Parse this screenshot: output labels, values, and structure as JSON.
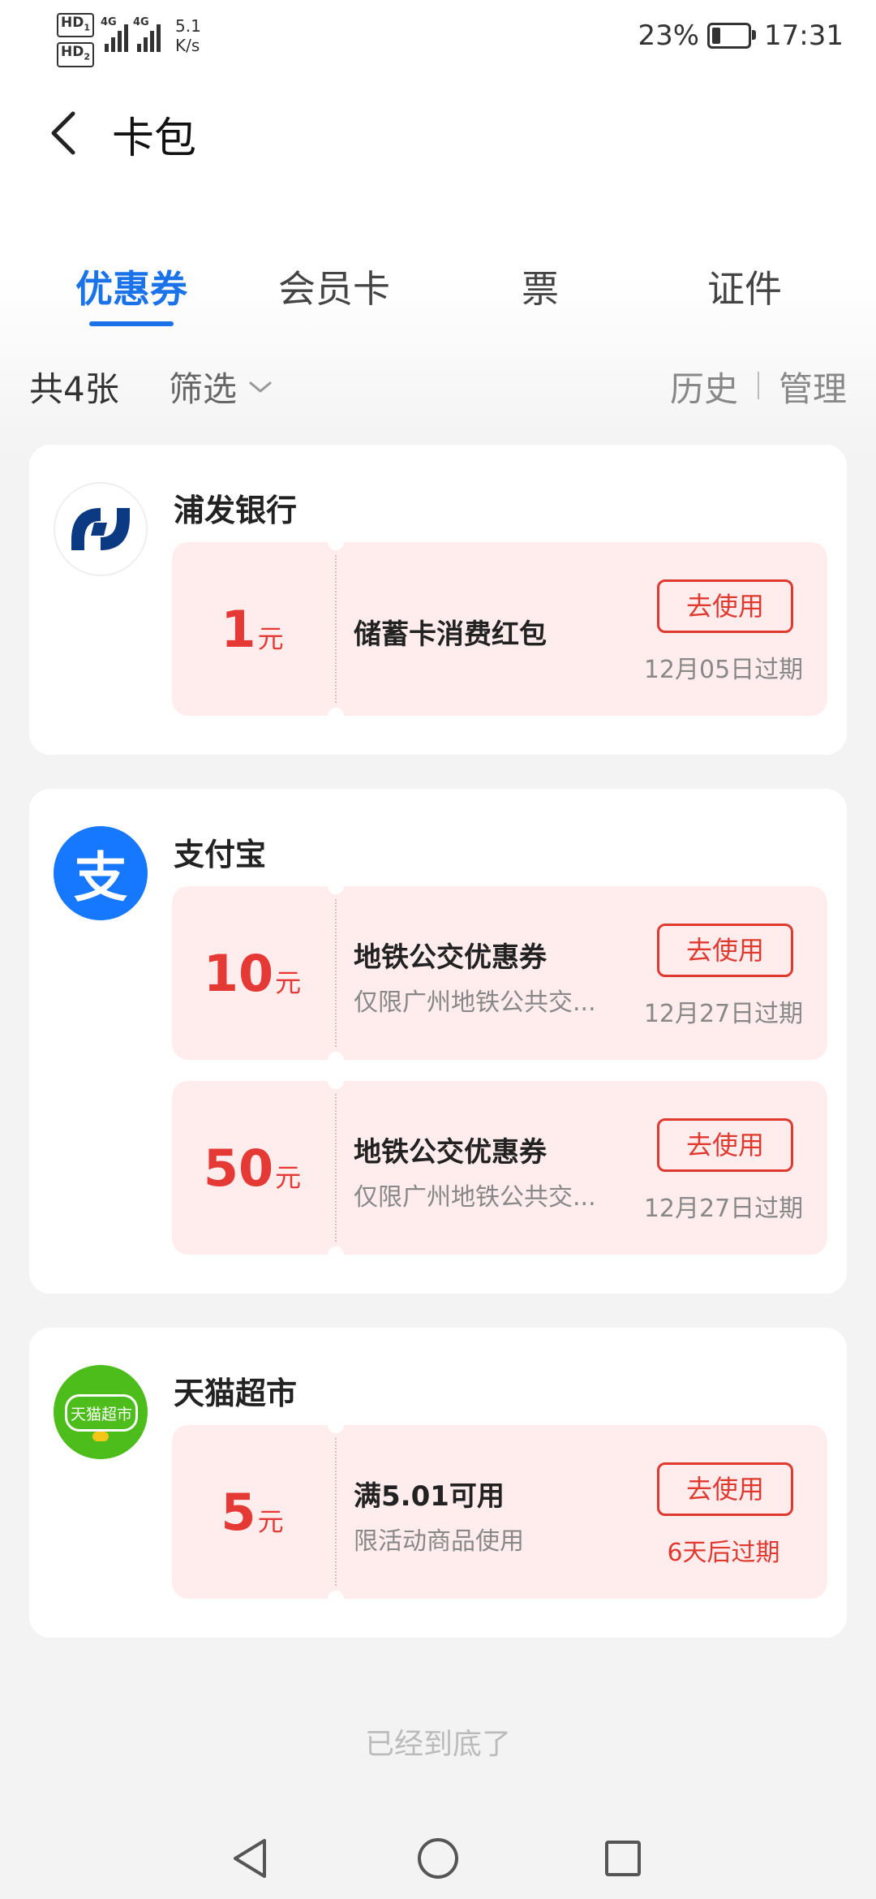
{
  "status_bar": {
    "hd1": "HD",
    "hd1_sub": "1",
    "hd2": "HD",
    "hd2_sub": "2",
    "net1": "4G",
    "net2": "4G",
    "speed_value": "5.1",
    "speed_unit": "K/s",
    "battery_percent": "23%",
    "battery_level": 0.23,
    "time": "17:31"
  },
  "header": {
    "title": "卡包"
  },
  "tabs": [
    {
      "label": "优惠券",
      "active": true
    },
    {
      "label": "会员卡",
      "active": false
    },
    {
      "label": "票",
      "active": false
    },
    {
      "label": "证件",
      "active": false
    }
  ],
  "summary": {
    "count": "共4张",
    "filter": "筛选",
    "history": "历史",
    "manage": "管理"
  },
  "cards": [
    {
      "merchant": "浦发银行",
      "coupons": [
        {
          "amount": "1",
          "unit": "元",
          "name": "储蓄卡消费红包",
          "desc": "",
          "button": "去使用",
          "expire": "12月05日过期"
        }
      ]
    },
    {
      "merchant": "支付宝",
      "coupons": [
        {
          "amount": "10",
          "unit": "元",
          "name": "地铁公交优惠券",
          "desc": "仅限广州地铁公共交...",
          "button": "去使用",
          "expire": "12月27日过期"
        },
        {
          "amount": "50",
          "unit": "元",
          "name": "地铁公交优惠券",
          "desc": "仅限广州地铁公共交...",
          "button": "去使用",
          "expire": "12月27日过期"
        }
      ]
    },
    {
      "merchant": "天猫超市",
      "logo_text": "天猫超市",
      "coupons": [
        {
          "amount": "5",
          "unit": "元",
          "name": "满5.01可用",
          "desc": "限活动商品使用",
          "button": "去使用",
          "expire": "6天后过期"
        }
      ]
    }
  ],
  "alipay_logo_char": "支",
  "bottom_note": "已经到底了",
  "colors": {
    "accent_blue": "#1a73e8",
    "coupon_red": "#e53935",
    "coupon_bg": "#ffeded",
    "spdb_blue": "#0b3a83",
    "alipay_blue": "#1677ff",
    "tmall_green": "#4cbd1a"
  }
}
